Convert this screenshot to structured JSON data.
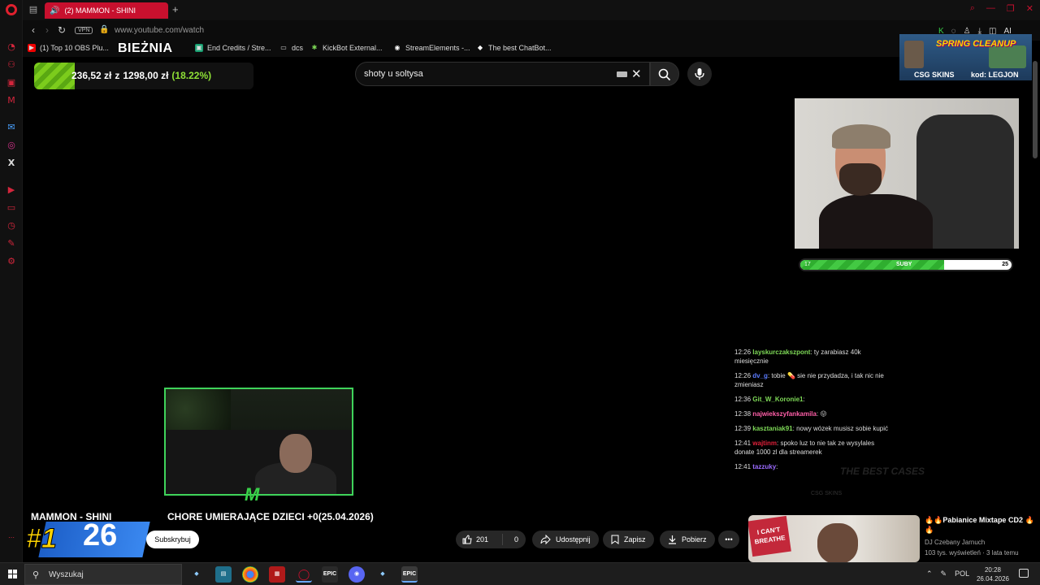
{
  "browser": {
    "tab_title": "(2) MAMMON - SHINI",
    "url": "www.youtube.com/watch",
    "vpn_label": "VPN",
    "bookmarks": [
      {
        "label": "(1) Top 10 OBS Plu...",
        "icon": "youtube-icon"
      },
      {
        "label": "BIEŻNIA",
        "icon": "globe-icon"
      },
      {
        "label": "End Credits / Stre...",
        "icon": "end-credits-icon"
      },
      {
        "label": "dcs",
        "icon": "folder-icon"
      },
      {
        "label": "KickBot External...",
        "icon": "kickbot-icon"
      },
      {
        "label": "StreamElements -...",
        "icon": "streamelements-icon"
      },
      {
        "label": "The best ChatBot...",
        "icon": "chatbot-icon"
      }
    ]
  },
  "treadmill": {
    "title": "BIEŻNIA",
    "current": "236,52 zł",
    "target": "1298,00 zł",
    "percent": "(18.22%)",
    "separator": "z"
  },
  "youtube": {
    "search_value": "shoty u soltysa",
    "video_title_left": "MAMMON - SHINI",
    "video_title_right": "CHORE UMIERAJĄCE DZIECI +0(25.04.2026)",
    "subscribe_label": "Subskrybuj",
    "like_count": "201",
    "dislike_count": "0",
    "share_label": "Udostępnij",
    "save_label": "Zapisz",
    "download_label": "Pobierz",
    "rank_badge": "#1",
    "rank_number": "26"
  },
  "ad": {
    "headline": "SPRING CLEANUP",
    "brand": "CSG SKINS",
    "code": "kod: LEGJON"
  },
  "subs_goal": {
    "current": "17",
    "label": "SUBY",
    "target": "25",
    "fill_fraction": 0.68
  },
  "chat": [
    {
      "time": "12:26",
      "user": "layskurczakszpont",
      "color": "#7ed957",
      "text": ": ty zarabiasz 40k miesięcznie"
    },
    {
      "time": "12:26",
      "user": "dv_g",
      "color": "#5b7cff",
      "text": ": tobie 💊 sie nie przydadza, i tak nic nie zmieniasz"
    },
    {
      "time": "12:36",
      "user": "Git_W_Koronie1",
      "color": "#7ed957",
      "text": ": "
    },
    {
      "time": "12:38",
      "user": "najwiekszyfankamila",
      "color": "#ff5fa8",
      "text": ": 😛"
    },
    {
      "time": "12:39",
      "user": "kasztaniak91",
      "color": "#7ed957",
      "text": ": nowy wózek musisz sobie kupić"
    },
    {
      "time": "12:41",
      "user": "wajtinm",
      "color": "#e0203a",
      "text": ": spoko luz to nie tak ze wysylales donate 1000 zl dla streamerek"
    },
    {
      "time": "12:41",
      "user": "tazzuky",
      "color": "#9b6bff",
      "text": ":"
    }
  ],
  "chat_watermark": "THE BEST CASES",
  "chat_watermark_sub": "CSG SKINS",
  "related": {
    "title": "🔥🔥Pabianice Mixtape CD2 🔥🔥",
    "channel": "DJ Czebany Jarnuch",
    "meta": "103 tys. wyświetleń · 3 lata temu",
    "thumb_text": "I CAN'T BREATHE"
  },
  "taskbar": {
    "search_placeholder": "Wyszukaj",
    "language": "POL",
    "time": "20:28",
    "date": "26.04.2026"
  },
  "colors": {
    "opera_red": "#c8102e",
    "treadmill_green": "#8fe036",
    "webcam_border": "#3fd35a",
    "rank_blue": "#2f7ae0"
  }
}
